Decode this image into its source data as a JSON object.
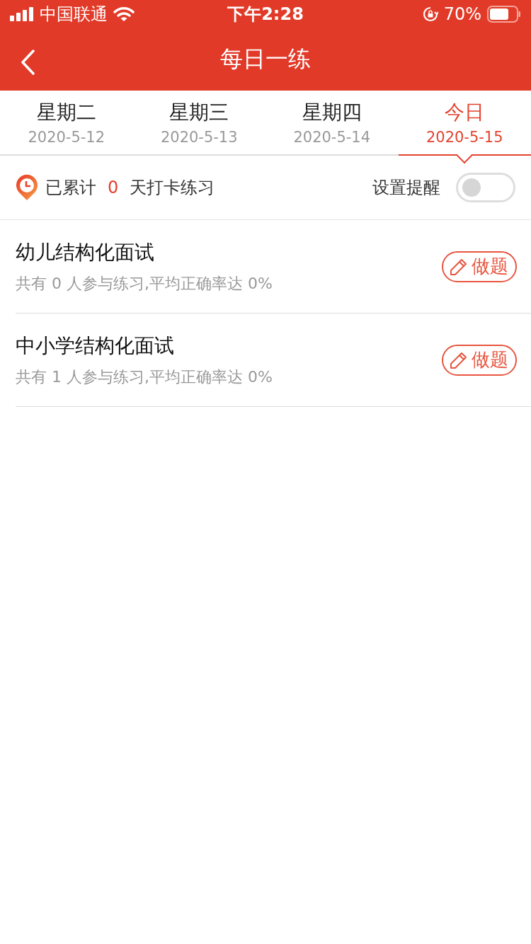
{
  "status_bar": {
    "carrier": "中国联通",
    "time": "下午2:28",
    "battery": "70%"
  },
  "nav_bar": {
    "title": "每日一练"
  },
  "tabs": [
    {
      "label": "星期二",
      "date": "2020-5-12",
      "selected": false
    },
    {
      "label": "星期三",
      "date": "2020-5-13",
      "selected": false
    },
    {
      "label": "星期四",
      "date": "2020-5-14",
      "selected": false
    },
    {
      "label": "今日",
      "date": "2020-5-15",
      "selected": true
    }
  ],
  "streak": {
    "prefix": "已累计",
    "count": "0",
    "suffix": "天打卡练习",
    "reminder_label": "设置提醒",
    "reminder_on": false
  },
  "practices": [
    {
      "title": "幼儿结构化面试",
      "stats": "共有 0 人参与练习,平均正确率达 0%",
      "button": "做题"
    },
    {
      "title": "中小学结构化面试",
      "stats": "共有 1 人参与练习,平均正确率达 0%",
      "button": "做题"
    }
  ]
}
